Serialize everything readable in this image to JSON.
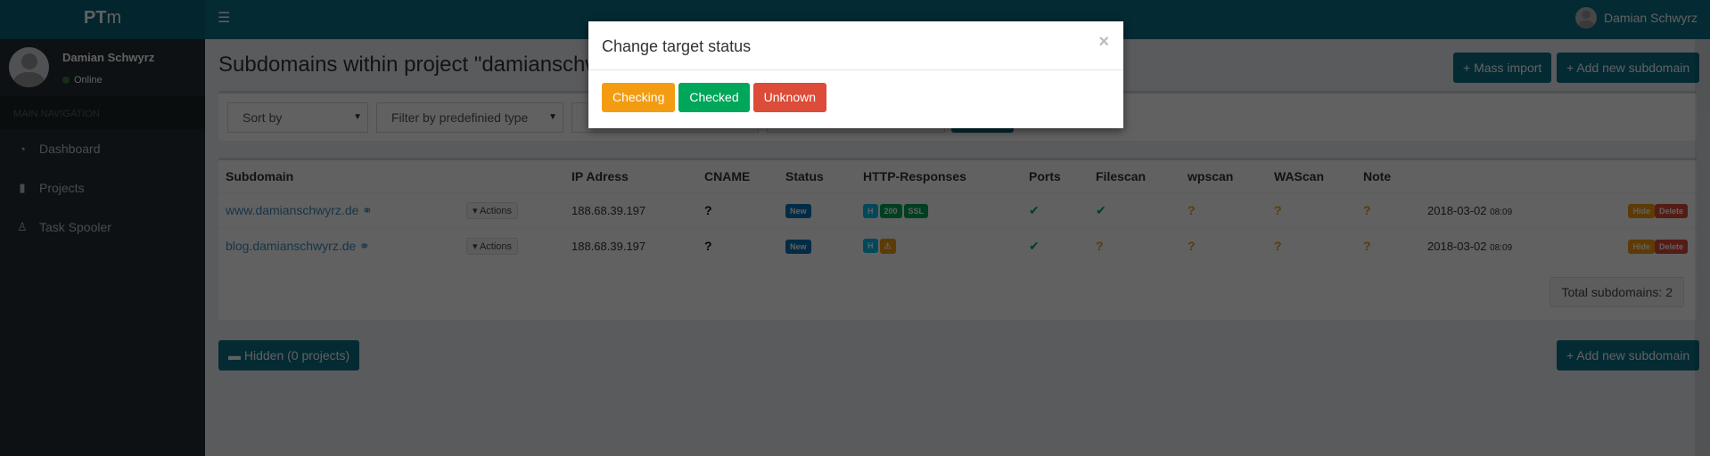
{
  "app": {
    "logo_bold": "PT",
    "logo_light": "m"
  },
  "header": {
    "menu_icon": "hamburger-icon",
    "user_name": "Damian Schwyrz"
  },
  "sidebar": {
    "user_name": "Damian Schwyrz",
    "status": "Online",
    "nav_header": "MAIN NAVIGATION",
    "items": [
      {
        "label": "Dashboard",
        "icon": "dashboard-icon",
        "glyph": "◔"
      },
      {
        "label": "Projects",
        "icon": "file-icon",
        "glyph": "▮"
      },
      {
        "label": "Task Spooler",
        "icon": "linux-icon",
        "glyph": "♙"
      }
    ]
  },
  "page": {
    "title": "Subdomains within project \"damianschwyrz.de\"",
    "mass_import": "+ Mass import",
    "add_new": "+ Add new subdomain",
    "hidden": "▬ Hidden (0 projects)",
    "total": "Total subdomains: 2"
  },
  "filters": {
    "sort": "Sort by",
    "type": "Filter by predefinied type"
  },
  "table": {
    "headers": [
      "Subdomain",
      "",
      "IP Adress",
      "CNAME",
      "Status",
      "HTTP-Responses",
      "Ports",
      "Filescan",
      "wpscan",
      "WAScan",
      "Note",
      "",
      ""
    ],
    "rows": [
      {
        "subdomain": "www.damianschwyrz.de",
        "actions": "▾ Actions",
        "ip": "188.68.39.197",
        "cname": "?",
        "status": "New",
        "http": [
          {
            "t": "H",
            "c": "#00c0ef"
          },
          {
            "t": "200",
            "c": "#00a65a"
          },
          {
            "t": "SSL",
            "c": "#00a65a"
          }
        ],
        "ports": "✔",
        "filescan": "✔",
        "wpscan": "?",
        "wascan": "?",
        "note": "?",
        "date": "2018-03-02",
        "time": "08:09",
        "hide": "Hide",
        "delete": "Delete"
      },
      {
        "subdomain": "blog.damianschwyrz.de",
        "actions": "▾ Actions",
        "ip": "188.68.39.197",
        "cname": "?",
        "status": "New",
        "http": [
          {
            "t": "H",
            "c": "#00c0ef"
          },
          {
            "t": "⚠",
            "c": "#f39c12"
          }
        ],
        "ports": "✔",
        "filescan": "?",
        "wpscan": "?",
        "wascan": "?",
        "note": "?",
        "date": "2018-03-02",
        "time": "08:09",
        "hide": "Hide",
        "delete": "Delete"
      }
    ]
  },
  "modal": {
    "title": "Change target status",
    "close": "×",
    "buttons": [
      {
        "label": "Checking",
        "color": "#f39c12"
      },
      {
        "label": "Checked",
        "color": "#00a65a"
      },
      {
        "label": "Unknown",
        "color": "#dd4b39"
      }
    ]
  },
  "colors": {
    "primary": "#0b6e86",
    "link": "#3c8dbc",
    "warning": "#f39c12",
    "success": "#00a65a",
    "danger": "#dd4b39",
    "info": "#00c0ef"
  }
}
